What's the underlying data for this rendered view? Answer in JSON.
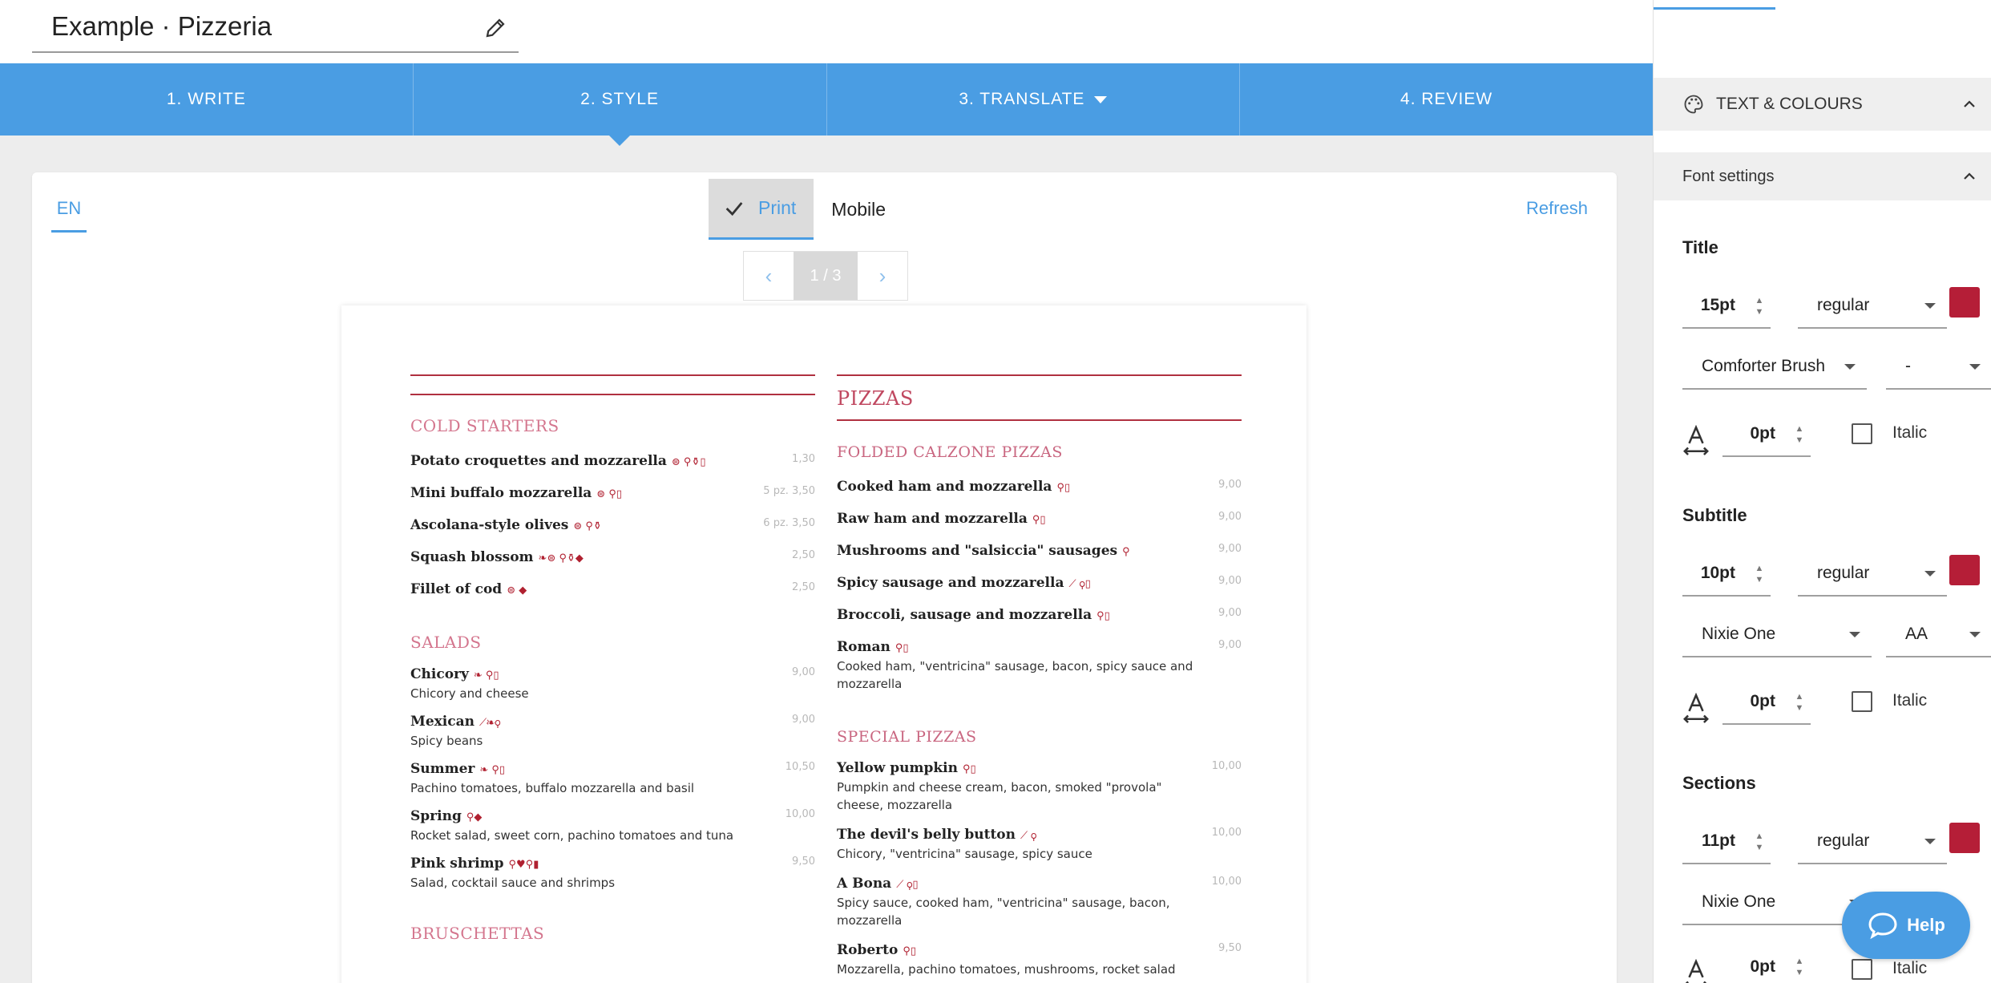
{
  "document": {
    "title": "Example · Pizzeria"
  },
  "steps": [
    {
      "label": "1. WRITE"
    },
    {
      "label": "2. STYLE"
    },
    {
      "label": "3. TRANSLATE"
    },
    {
      "label": "4. REVIEW"
    }
  ],
  "preview": {
    "language_tab": "EN",
    "mode_print": "Print",
    "mode_mobile": "Mobile",
    "refresh": "Refresh",
    "pager": {
      "prev": "‹",
      "current": "1 / 3",
      "next": "›"
    }
  },
  "menu": {
    "left": {
      "cold_starters": {
        "title": "COLD STARTERS",
        "items": [
          {
            "name": "Potato croquettes and mozzarella",
            "icons": "⊜ ⚲⚱▯",
            "price": "1,30"
          },
          {
            "name": "Mini buffalo mozzarella",
            "icons": "⊜ ⚲▯",
            "price": "5 pz. 3,50"
          },
          {
            "name": "Ascolana-style olives",
            "icons": "⊜ ⚲⚱",
            "price": "6 pz. 3,50"
          },
          {
            "name": "Squash blossom",
            "icons": "❧⊜ ⚲⚱◆",
            "price": "2,50"
          },
          {
            "name": "Fillet of cod",
            "icons": "⊜ ◆",
            "price": "2,50"
          }
        ]
      },
      "salads": {
        "title": "SALADS",
        "items": [
          {
            "name": "Chicory",
            "icons": "❧ ⚲▯",
            "desc": "Chicory and cheese",
            "price": "9,00"
          },
          {
            "name": "Mexican",
            "icons": "⟋❧⚲",
            "desc": "Spicy beans",
            "price": "9,00"
          },
          {
            "name": "Summer",
            "icons": "❧ ⚲▯",
            "desc": "Pachino tomatoes, buffalo mozzarella and basil",
            "price": "10,50"
          },
          {
            "name": "Spring",
            "icons": "⚲◆",
            "desc": "Rocket salad, sweet corn, pachino tomatoes and tuna",
            "price": "10,00"
          },
          {
            "name": "Pink shrimp",
            "icons": "⚲♥⚲▮",
            "desc": "Salad, cocktail sauce and shrimps",
            "price": "9,50"
          }
        ]
      },
      "bruschettas": {
        "title": "BRUSCHETTAS"
      }
    },
    "right": {
      "pizzas": {
        "title": "PIZZAS"
      },
      "folded": {
        "title": "FOLDED CALZONE PIZZAS",
        "items": [
          {
            "name": "Cooked ham and mozzarella",
            "icons": "⚲▯",
            "price": "9,00"
          },
          {
            "name": "Raw ham and mozzarella",
            "icons": "⚲▯",
            "price": "9,00"
          },
          {
            "name": "Mushrooms and \"salsiccia\" sausages",
            "icons": "⚲",
            "price": "9,00"
          },
          {
            "name": "Spicy sausage and mozzarella",
            "icons": "⟋ ⚲▯",
            "price": "9,00"
          },
          {
            "name": "Broccoli, sausage and mozzarella",
            "icons": "⚲▯",
            "price": "9,00"
          },
          {
            "name": "Roman",
            "icons": "⚲▯",
            "desc": "Cooked ham, \"ventricina\" sausage, bacon, spicy sauce and mozzarella",
            "price": "9,00"
          }
        ]
      },
      "special": {
        "title": "SPECIAL PIZZAS",
        "items": [
          {
            "name": "Yellow pumpkin",
            "icons": "⚲▯",
            "desc": "Pumpkin and cheese cream, bacon, smoked \"provola\" cheese, mozzarella",
            "price": "10,00"
          },
          {
            "name": "The devil's belly button",
            "icons": "⟋ ⚲",
            "desc": "Chicory, \"ventricina\" sausage, spicy sauce",
            "price": "10,00"
          },
          {
            "name": "A Bona",
            "icons": "⟋ ⚲▯",
            "desc": "Spicy sauce, cooked ham, \"ventricina\" sausage, bacon, mozzarella",
            "price": "10,00"
          },
          {
            "name": "Roberto",
            "icons": "⚲▯",
            "desc": "Mozzarella, pachino tomatoes, mushrooms, rocket salad",
            "price": "9,50"
          }
        ]
      }
    }
  },
  "panel": {
    "section_header": "TEXT & COLOURS",
    "font_settings": "Font settings",
    "title": {
      "label": "Title",
      "size": "15pt",
      "weight": "regular",
      "font": "Comforter Brush",
      "case": "-",
      "spacing": "0pt",
      "italic": "Italic",
      "color": "#b51e37"
    },
    "subtitle": {
      "label": "Subtitle",
      "size": "10pt",
      "weight": "regular",
      "font": "Nixie One",
      "case": "AA",
      "spacing": "0pt",
      "italic": "Italic",
      "color": "#b51e37"
    },
    "sections": {
      "label": "Sections",
      "size": "11pt",
      "weight": "regular",
      "font": "Nixie One",
      "spacing": "0pt",
      "italic": "Italic",
      "color": "#b51e37"
    }
  },
  "help": {
    "label": "Help"
  },
  "colors": {
    "accent": "#4a9de3",
    "brand_red": "#b51e37"
  }
}
